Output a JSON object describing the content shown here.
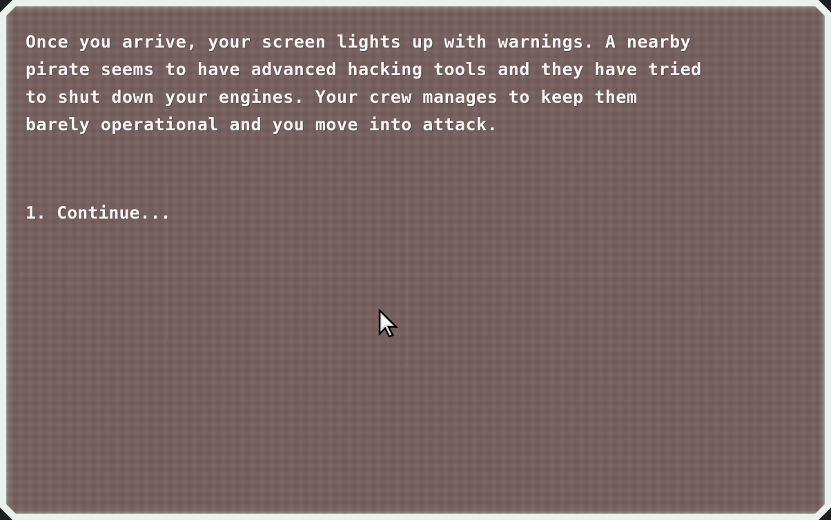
{
  "event": {
    "text": "Once you arrive, your screen lights up with warnings. A nearby\npirate seems to have advanced hacking tools and they have tried\nto shut down your engines. Your crew manages to keep them\nbarely operational and you move into attack.",
    "choices": [
      {
        "label": "1. Continue..."
      }
    ]
  },
  "icons": {
    "cursor": "mouse-cursor-icon"
  },
  "colors": {
    "frame": "#e8f1ec",
    "panel": "#76605f",
    "text": "#f4f4f4"
  }
}
